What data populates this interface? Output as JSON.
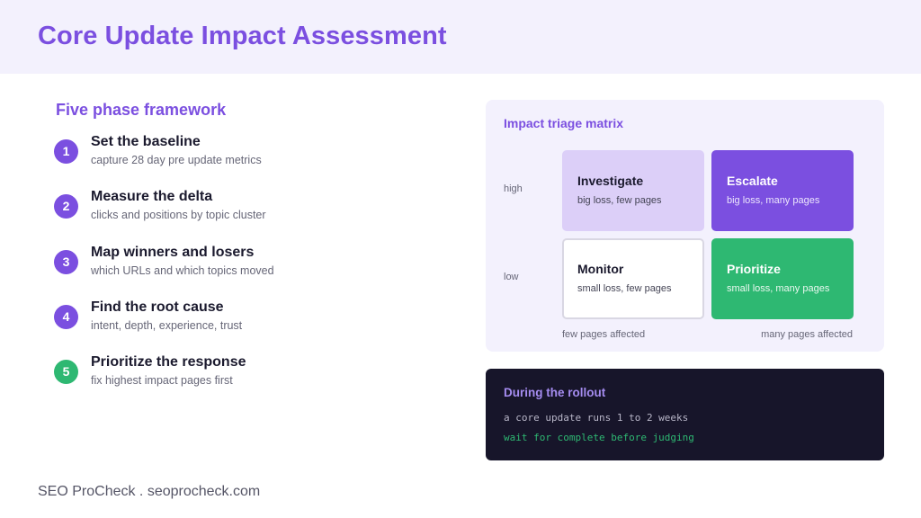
{
  "header": {
    "title": "Core Update Impact Assessment"
  },
  "framework": {
    "title": "Five phase framework",
    "steps": [
      {
        "num": "1",
        "title": "Set the baseline",
        "desc": "capture 28 day pre update metrics"
      },
      {
        "num": "2",
        "title": "Measure the delta",
        "desc": "clicks and positions by topic cluster"
      },
      {
        "num": "3",
        "title": "Map winners and losers",
        "desc": "which URLs and which topics moved"
      },
      {
        "num": "4",
        "title": "Find the root cause",
        "desc": "intent, depth, experience, trust"
      },
      {
        "num": "5",
        "title": "Prioritize the response",
        "desc": "fix highest impact pages first"
      }
    ]
  },
  "matrix": {
    "title": "Impact triage matrix",
    "y_high": "high",
    "y_low": "low",
    "x_few": "few pages affected",
    "x_many": "many pages affected",
    "cells": {
      "investigate": {
        "title": "Investigate",
        "desc": "big loss, few pages"
      },
      "escalate": {
        "title": "Escalate",
        "desc": "big loss, many pages"
      },
      "monitor": {
        "title": "Monitor",
        "desc": "small loss, few pages"
      },
      "prioritize": {
        "title": "Prioritize",
        "desc": "small loss, many pages"
      }
    }
  },
  "rollout": {
    "title": "During the rollout",
    "line1": "a core update runs 1 to 2 weeks",
    "line2": "wait for complete before judging"
  },
  "footer": {
    "text": "SEO ProCheck . seoprocheck.com"
  },
  "colors": {
    "accent": "#7b4fe0",
    "green": "#2eb872",
    "dark": "#17152a",
    "light_bg": "#f3f1fd"
  }
}
